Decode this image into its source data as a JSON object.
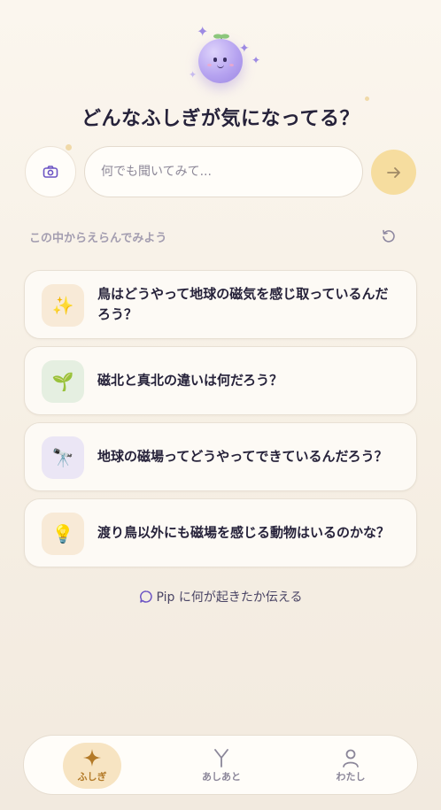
{
  "header": {
    "headline": "どんなふしぎが気になってる？"
  },
  "search": {
    "placeholder": "何でも聞いてみて..."
  },
  "suggestions": {
    "label": "この中からえらんでみよう",
    "items": [
      {
        "icon": "sparkles-icon",
        "emoji": "✨",
        "text": "鳥はどうやって地球の磁気を感じ取っているんだろう？"
      },
      {
        "icon": "sprout-icon",
        "emoji": "🌱",
        "text": "磁北と真北の違いは何だろう？"
      },
      {
        "icon": "telescope-icon",
        "emoji": "🔭",
        "text": "地球の磁場ってどうやってできているんだろう？"
      },
      {
        "icon": "lightbulb-icon",
        "emoji": "💡",
        "text": "渡り鳥以外にも磁場を感じる動物はいるのかな？"
      }
    ]
  },
  "report": {
    "label": "Pip に何が起きたか伝える"
  },
  "nav": {
    "items": [
      {
        "label": "ふしぎ",
        "icon": "sparkle-icon",
        "active": true
      },
      {
        "label": "あしあと",
        "icon": "footprint-icon",
        "active": false
      },
      {
        "label": "わたし",
        "icon": "person-icon",
        "active": false
      }
    ]
  },
  "colors": {
    "accent": "#f6dd9f",
    "active_nav_bg": "#f7e4c2",
    "active_nav_text": "#b37a28",
    "mascot": "#b6a3f0"
  }
}
